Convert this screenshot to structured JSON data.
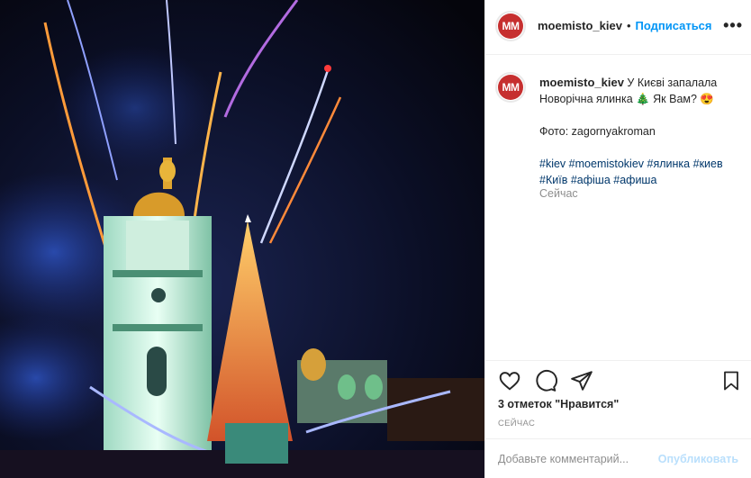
{
  "post": {
    "username": "moemisto_kiev",
    "avatar_text": "MM",
    "follow_label": "Подписаться",
    "separator": "•",
    "more_label": "•••",
    "caption_line1": "У Києві запалала",
    "caption_line2": "Новорічна ялинка 🎄 Як Вам? 😍",
    "photo_credit": "Фото: zagornyakroman",
    "hashtags_line1": [
      "#kiev",
      "#moemistokiev",
      "#ялинка",
      "#киев"
    ],
    "hashtags_line2": [
      "#Київ",
      "#афіша",
      "#афиша"
    ],
    "caption_time": "Сейчас",
    "likes_text": "3 отметок \"Нравится\"",
    "time_label": "СЕЙЧАС",
    "comment_placeholder": "Добавьте комментарий...",
    "publish_label": "Опубликовать"
  },
  "icons": [
    "heart-icon",
    "comment-icon",
    "share-icon",
    "bookmark-icon"
  ],
  "colors": {
    "accent": "#0095f6",
    "avatar_bg": "#c62f2f",
    "hashtag": "#00376b",
    "muted": "#8e8e8e"
  }
}
